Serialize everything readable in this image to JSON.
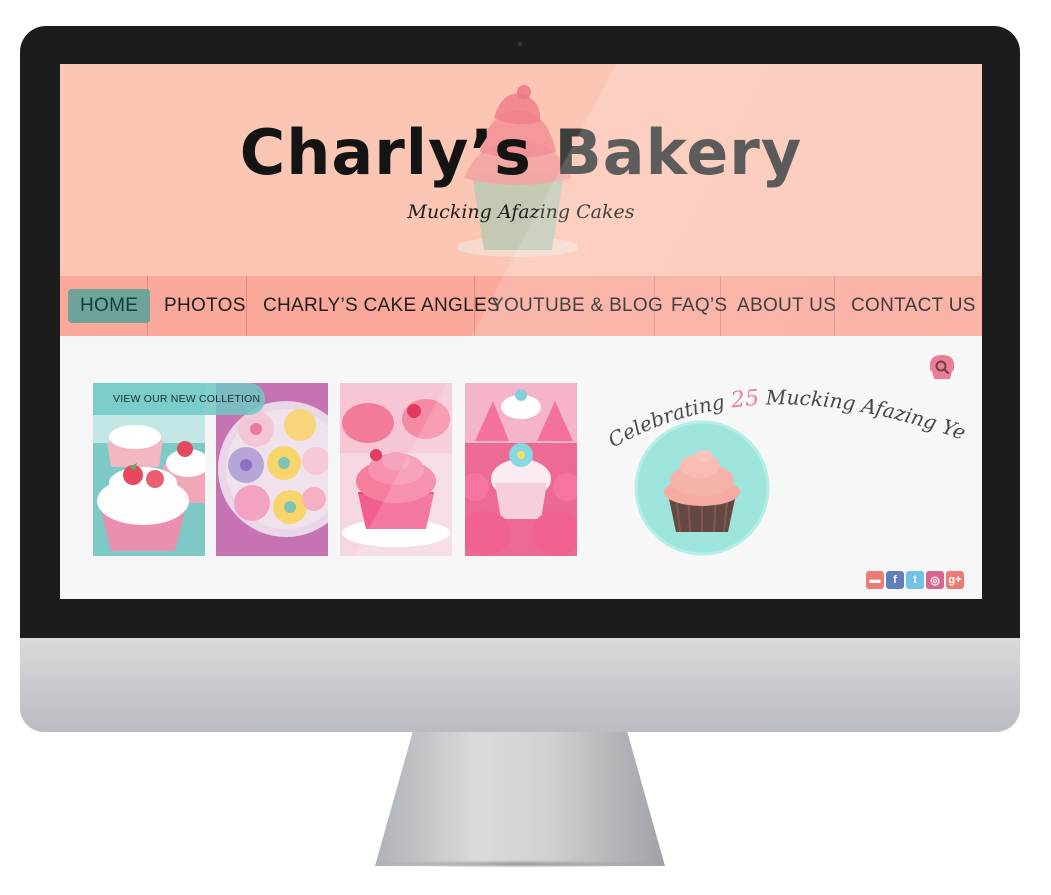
{
  "site": {
    "title_part1": "Charly’s",
    "title_part2": "Bakery",
    "tagline": "Mucking Afazing Cakes"
  },
  "nav": {
    "items": [
      {
        "label": "HOME",
        "active": true
      },
      {
        "label": "PHOTOS",
        "active": false
      },
      {
        "label": "CHARLY’S CAKE ANGLES",
        "active": false
      },
      {
        "label": "YOUTUBE & BLOG",
        "active": false
      },
      {
        "label": "FAQ’S",
        "active": false
      },
      {
        "label": "ABOUT US",
        "active": false
      },
      {
        "label": "CONTACT US",
        "active": false
      }
    ]
  },
  "collection": {
    "label": "VIEW OUR NEW COLLETION"
  },
  "celebration": {
    "prefix": "Celebrating",
    "number": "25",
    "suffix": "Mucking Afazing Years!"
  },
  "social": {
    "icons": [
      "youtube-icon",
      "facebook-icon",
      "twitter-icon",
      "instagram-icon",
      "google-plus-icon"
    ],
    "glyphs": [
      "▬",
      "f",
      "t",
      "◎",
      "g+"
    ],
    "colors": [
      "#e8695f",
      "#4c6cb0",
      "#5fb8e6",
      "#d24f7f",
      "#e8695f"
    ]
  },
  "colors": {
    "header_bg": "#fcc6b5",
    "nav_bg": "#f9a899",
    "nav_active_bg": "#6fa298",
    "accent_pink": "#e86a86",
    "teal": "#8de0d7"
  }
}
